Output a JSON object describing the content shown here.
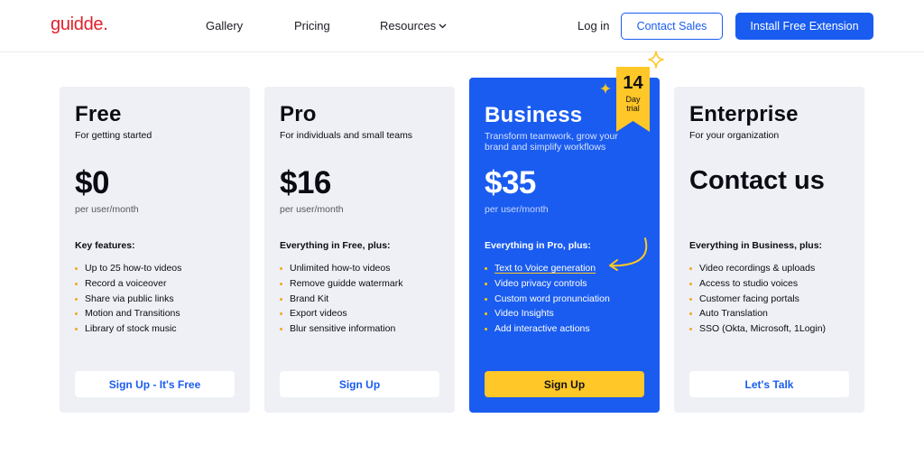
{
  "header": {
    "logo": "guidde.",
    "nav": {
      "gallery": "Gallery",
      "pricing": "Pricing",
      "resources": "Resources"
    },
    "login": "Log in",
    "contact_sales": "Contact Sales",
    "install": "Install Free Extension"
  },
  "colors": {
    "brand_blue": "#1a5cf0",
    "accent_yellow": "#ffc727",
    "logo_red": "#e0212b",
    "card_bg": "#eef0f5"
  },
  "plans": [
    {
      "name": "Free",
      "subtitle": "For getting started",
      "price": "$0",
      "per": "per user/month",
      "features_title": "Key features:",
      "features": [
        "Up to 25 how-to videos",
        "Record a voiceover",
        "Share via public links",
        "Motion and Transitions",
        "Library of stock music"
      ],
      "cta": "Sign Up - It's Free"
    },
    {
      "name": "Pro",
      "subtitle": "For individuals and small teams",
      "price": "$16",
      "per": "per user/month",
      "features_title": "Everything in Free, plus:",
      "features": [
        "Unlimited how-to videos",
        "Remove guidde watermark",
        "Brand Kit",
        "Export videos",
        "Blur sensitive information"
      ],
      "cta": "Sign Up"
    },
    {
      "name": "Business",
      "subtitle": "Transform teamwork, grow your brand and simplify workflows",
      "price": "$35",
      "per": "per user/month",
      "features_title": "Everything in Pro, plus:",
      "features": [
        "Text to Voice generation",
        "Video privacy controls",
        "Custom word pronunciation",
        "Video Insights",
        "Add interactive actions"
      ],
      "cta": "Sign Up",
      "badge": {
        "number": "14",
        "line1": "Day",
        "line2": "trial"
      }
    },
    {
      "name": "Enterprise",
      "subtitle": "For your organization",
      "price": "Contact us",
      "features_title": "Everything in Business, plus:",
      "features": [
        "Video recordings & uploads",
        "Access to studio voices",
        "Customer facing portals",
        "Auto Translation",
        "SSO (Okta, Microsoft, 1Login)"
      ],
      "cta": "Let's Talk"
    }
  ]
}
